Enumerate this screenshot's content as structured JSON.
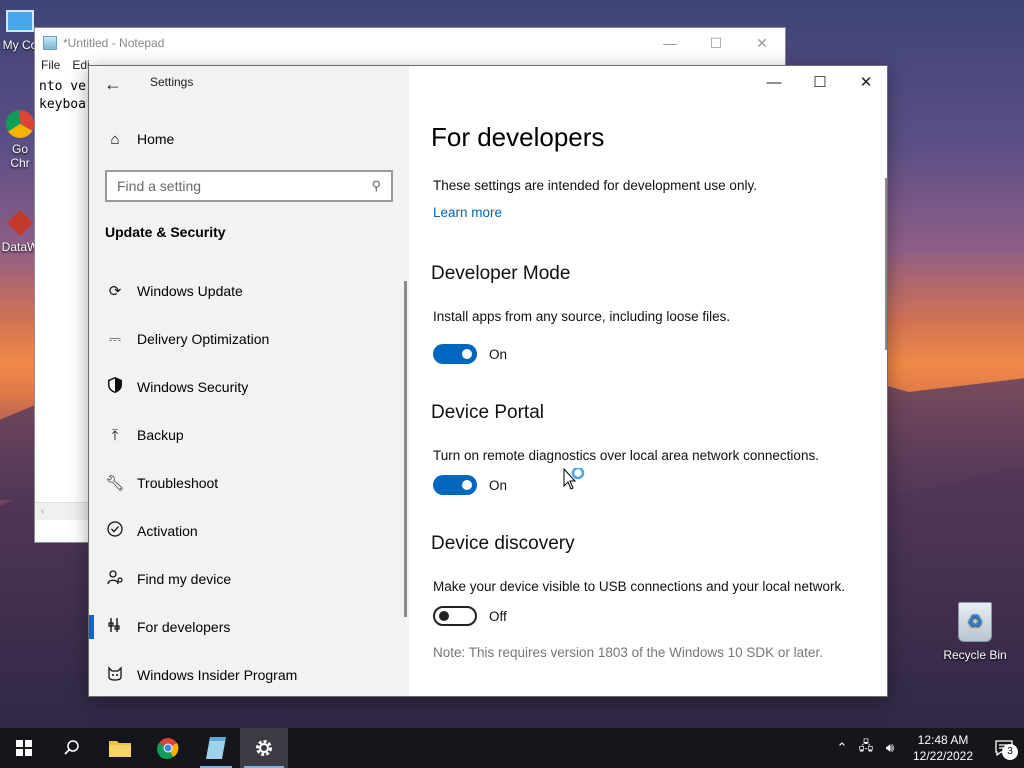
{
  "desktop": {
    "icons": {
      "my_computer": "My Co",
      "chrome_line1": "Go",
      "chrome_line2": "Chr",
      "dataw": "DataW",
      "recycle_bin": "Recycle Bin"
    }
  },
  "notepad": {
    "title": "*Untitled - Notepad",
    "menu": [
      "File",
      "Edi"
    ],
    "text_line1": "nto ve",
    "text_line2": "keyboa"
  },
  "settings": {
    "title": "Settings",
    "home_label": "Home",
    "search_placeholder": "Find a setting",
    "section_heading": "Update & Security",
    "nav_items": [
      {
        "label": "Windows Update",
        "icon": "refresh-icon"
      },
      {
        "label": "Delivery Optimization",
        "icon": "delivery-optimization-icon"
      },
      {
        "label": "Windows Security",
        "icon": "shield-icon"
      },
      {
        "label": "Backup",
        "icon": "backup-arrow-icon"
      },
      {
        "label": "Troubleshoot",
        "icon": "wrench-icon"
      },
      {
        "label": "Activation",
        "icon": "check-circle-icon"
      },
      {
        "label": "Find my device",
        "icon": "person-location-icon"
      },
      {
        "label": "For developers",
        "icon": "developer-tools-icon"
      },
      {
        "label": "Windows Insider Program",
        "icon": "insider-cat-icon"
      }
    ],
    "active_nav": "For developers",
    "accent_color": "#0067c0",
    "content": {
      "page_title": "For developers",
      "intro": "These settings are intended for development use only.",
      "learn_more": "Learn more",
      "developer_mode": {
        "heading": "Developer Mode",
        "description": "Install apps from any source, including loose files.",
        "toggle_state": "On"
      },
      "device_portal": {
        "heading": "Device Portal",
        "description": "Turn on remote diagnostics over local area network connections.",
        "toggle_state": "On"
      },
      "device_discovery": {
        "heading": "Device discovery",
        "description": "Make your device visible to USB connections and your local network.",
        "toggle_state": "Off",
        "note": "Note: This requires version 1803 of the Windows 10 SDK or later."
      }
    }
  },
  "taskbar": {
    "clock_time": "12:48 AM",
    "clock_date": "12/22/2022",
    "notification_count": "3"
  }
}
